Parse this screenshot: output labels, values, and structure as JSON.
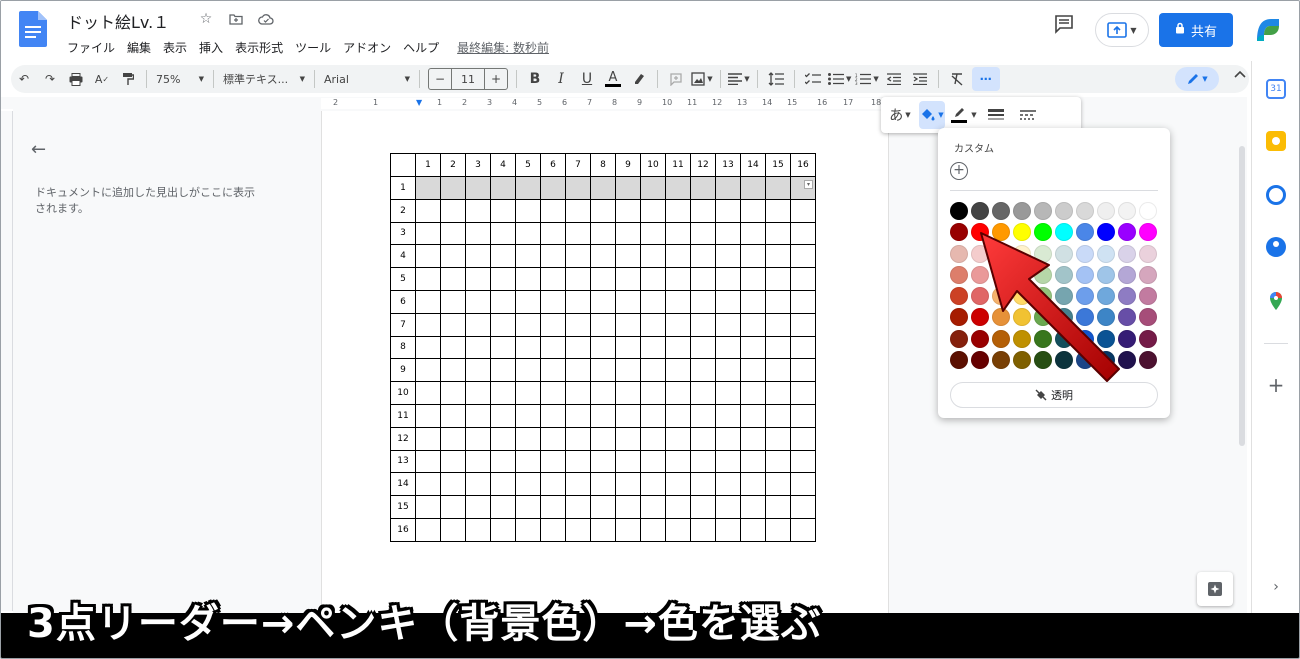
{
  "header": {
    "doc_title": "ドット絵Lv.１",
    "menus": [
      "ファイル",
      "編集",
      "表示",
      "挿入",
      "表示形式",
      "ツール",
      "アドオン",
      "ヘルプ"
    ],
    "last_edit": "最終編集: 数秒前",
    "share_label": "共有"
  },
  "toolbar": {
    "zoom": "75%",
    "style": "標準テキス...",
    "font": "Arial",
    "font_size": "11",
    "minus": "−",
    "plus": "+",
    "bold": "B",
    "italic": "I",
    "underline": "U",
    "text_color": "A"
  },
  "ruler": {
    "ticks": [
      "2",
      "1",
      "1",
      "2",
      "3",
      "4",
      "5",
      "6",
      "7",
      "8",
      "9",
      "10",
      "11",
      "12",
      "13",
      "14",
      "15",
      "16",
      "17",
      "18"
    ]
  },
  "outline": {
    "hint": "ドキュメントに追加した見出しがここに表示されます。"
  },
  "table": {
    "columns": [
      "1",
      "2",
      "3",
      "4",
      "5",
      "6",
      "7",
      "8",
      "9",
      "10",
      "11",
      "12",
      "13",
      "14",
      "15",
      "16"
    ],
    "rows": [
      "1",
      "2",
      "3",
      "4",
      "5",
      "6",
      "7",
      "8",
      "9",
      "10",
      "11",
      "12",
      "13",
      "14",
      "15",
      "16"
    ],
    "selected_row": "1"
  },
  "floatbar": {
    "lang": "あ"
  },
  "palette": {
    "custom_label": "カスタム",
    "transparent_label": "透明",
    "rows": [
      [
        "#000000",
        "#434343",
        "#666666",
        "#999999",
        "#b7b7b7",
        "#cccccc",
        "#d9d9d9",
        "#efefef",
        "#f3f3f3",
        "#ffffff"
      ],
      [
        "#980000",
        "#ff0000",
        "#ff9900",
        "#ffff00",
        "#00ff00",
        "#00ffff",
        "#4a86e8",
        "#0000ff",
        "#9900ff",
        "#ff00ff"
      ],
      [
        "#e6b8af",
        "#f4cccc",
        "#fce5cd",
        "#fff2cc",
        "#d9ead3",
        "#d0e0e3",
        "#c9daf8",
        "#cfe2f3",
        "#d9d2e9",
        "#ead1dc"
      ],
      [
        "#dd7e6b",
        "#ea9999",
        "#f9cb9c",
        "#ffe599",
        "#b6d7a8",
        "#a2c4c9",
        "#a4c2f4",
        "#9fc5e8",
        "#b4a7d6",
        "#d5a6bd"
      ],
      [
        "#cc4125",
        "#e06666",
        "#f6b26b",
        "#ffd966",
        "#93c47d",
        "#76a5af",
        "#6d9eeb",
        "#6fa8dc",
        "#8e7cc3",
        "#c27ba0"
      ],
      [
        "#a61c00",
        "#cc0000",
        "#e69138",
        "#f1c232",
        "#6aa84f",
        "#45818e",
        "#3c78d8",
        "#3d85c6",
        "#674ea7",
        "#a64d79"
      ],
      [
        "#85200c",
        "#990000",
        "#b45f06",
        "#bf9000",
        "#38761d",
        "#134f5c",
        "#1155cc",
        "#0b5394",
        "#351c75",
        "#741b47"
      ],
      [
        "#5b0f00",
        "#660000",
        "#783f04",
        "#7f6000",
        "#274e13",
        "#0c343d",
        "#1c4587",
        "#073763",
        "#20124d",
        "#4c1130"
      ]
    ]
  },
  "caption": "3点リーダー→ペンキ（背景色）→色を選ぶ",
  "colors": {
    "accent": "#1a73e8",
    "arrow": "#cc0000"
  }
}
